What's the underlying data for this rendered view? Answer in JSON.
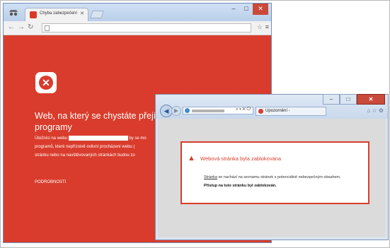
{
  "chrome": {
    "tab_title": "Chyba zabezpečení",
    "headline": "Web, na který se chystáte přejít, o",
    "headline_line2": "programy",
    "body": {
      "line1_prefix": "Útočníci na webu",
      "line1_suffix": "by se mo",
      "line2": "programů, které nepříznivě ovlivní procházení webu (",
      "line3": "stránku nebo na navštěvovaných stránkách budou zo"
    },
    "details_link": "PODROBNOSTI",
    "colors": {
      "danger": "#d93c2c"
    }
  },
  "ie": {
    "tab_title": "Upozornění -",
    "alert": {
      "title": "Webová stránka byla zablokována",
      "line1_link": "Stránka",
      "line1_rest": " se nachází na seznamu stránek s potenciálně nebezpečným obsahem.",
      "line2": "Přístup na tuto stránku byl zablokován."
    }
  }
}
